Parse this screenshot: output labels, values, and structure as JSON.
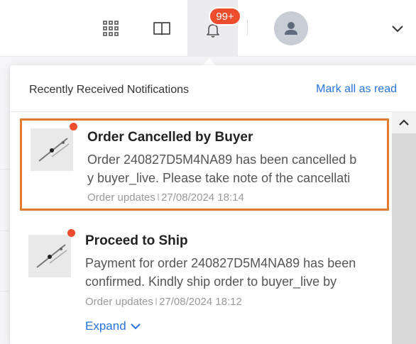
{
  "topbar": {
    "icons": [
      "apps-grid-icon",
      "book-icon",
      "bell-icon",
      "user-avatar-icon",
      "chevron-down-icon"
    ],
    "notification_badge": "99+"
  },
  "notifications_panel": {
    "title": "Recently Received Notifications",
    "mark_all_read": "Mark all as read",
    "items": [
      {
        "title": "Order Cancelled by Buyer",
        "body_line1": "Order 240827D5M4NA89 has been cancelled b",
        "body_line2": "y buyer_live. Please take note of the cancellati",
        "category": "Order updates",
        "timestamp": "27/08/2024 18:14",
        "unread": true,
        "highlighted": true
      },
      {
        "title": "Proceed to Ship",
        "body_line1": "Payment for order 240827D5M4NA89 has been",
        "body_line2": "confirmed. Kindly ship order to buyer_live by",
        "category": "Order updates",
        "timestamp": "27/08/2024 18:12",
        "unread": true,
        "expand_label": "Expand"
      }
    ]
  },
  "colors": {
    "accent_blue": "#2673dd",
    "badge_red": "#ee4d2d",
    "highlight_orange": "#e07a30"
  }
}
